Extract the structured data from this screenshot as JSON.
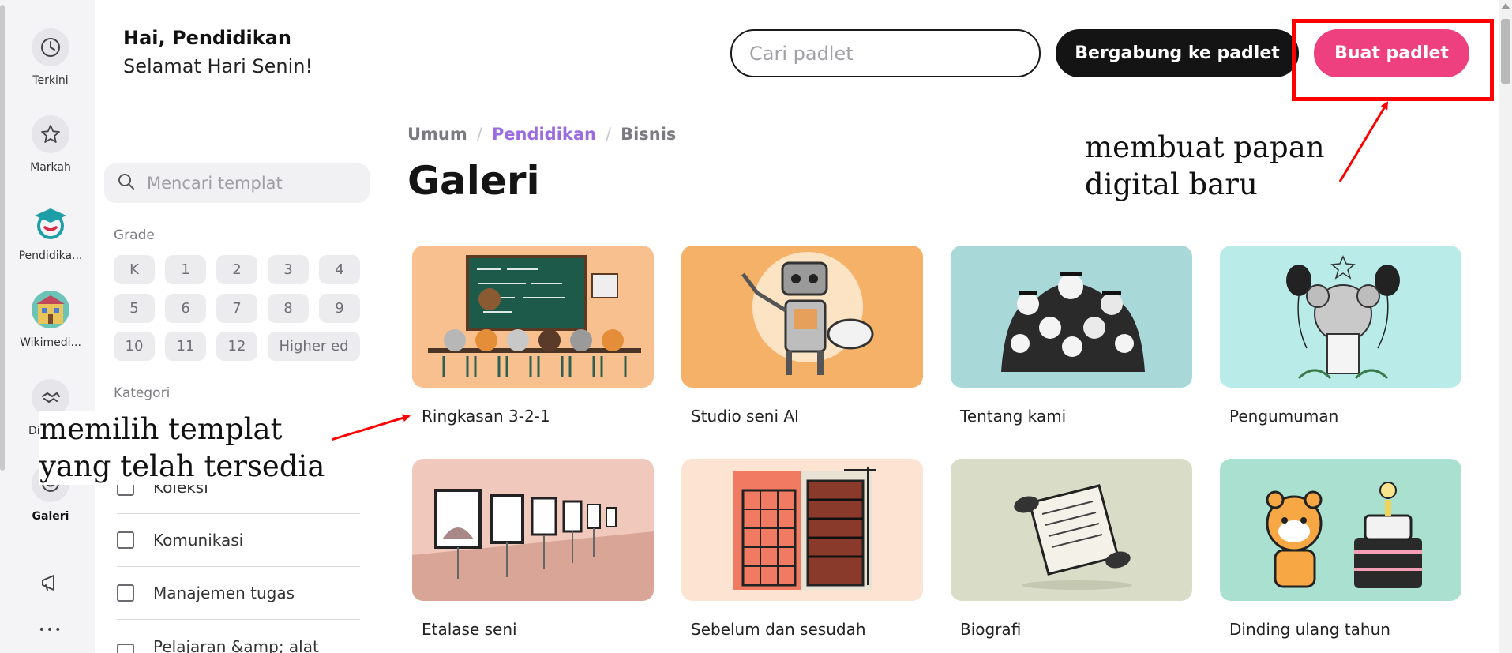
{
  "rail": {
    "items": [
      {
        "label": "Terkini",
        "icon": "clock-icon"
      },
      {
        "label": "Markah",
        "icon": "star-icon"
      },
      {
        "label": "Pendidika...",
        "icon": "graduation-cap-icon"
      },
      {
        "label": "Wikimedi...",
        "icon": "building-avatar-icon"
      },
      {
        "label": "Dis",
        "icon": "handshake-icon"
      },
      {
        "label": "Galeri",
        "icon": "gallery-icon"
      },
      {
        "label": "",
        "icon": "megaphone-icon"
      },
      {
        "label": "",
        "icon": "more-icon"
      }
    ],
    "more_glyph": "•••"
  },
  "header": {
    "greeting": "Hai, Pendidikan",
    "day_message": "Selamat Hari Senin!",
    "search_placeholder": "Cari padlet",
    "join_label": "Bergabung ke padlet",
    "create_label": "Buat padlet"
  },
  "filters": {
    "search_placeholder": "Mencari templat",
    "grade_label": "Grade",
    "grades": [
      "K",
      "1",
      "2",
      "3",
      "4",
      "5",
      "6",
      "7",
      "8",
      "9",
      "10",
      "11",
      "12",
      "Higher ed"
    ],
    "category_label": "Kategori",
    "categories": [
      "Koleksi",
      "Komunikasi",
      "Manajemen tugas",
      "Pelajaran &amp; alat"
    ]
  },
  "main": {
    "breadcrumb": [
      "Umum",
      "Pendidikan",
      "Bisnis"
    ],
    "breadcrumb_separator": "/",
    "title": "Galeri",
    "cards": [
      {
        "title": "Ringkasan 3-2-1",
        "bg": "#f8c08e"
      },
      {
        "title": "Studio seni AI",
        "bg": "#f6b168"
      },
      {
        "title": "Tentang kami",
        "bg": "#a9d8d8"
      },
      {
        "title": "Pengumuman",
        "bg": "#b9ece8"
      },
      {
        "title": "Etalase seni",
        "bg": "#f1c8bc"
      },
      {
        "title": "Sebelum dan sesudah",
        "bg": "#fde3d1"
      },
      {
        "title": "Biografi",
        "bg": "#d9dcc6"
      },
      {
        "title": "Dinding ulang tahun",
        "bg": "#a9e0cf"
      }
    ]
  },
  "annotations": {
    "create_note": [
      "membuat papan",
      "digital baru"
    ],
    "template_note": [
      "memilih templat",
      "yang telah tersedia"
    ]
  },
  "colors": {
    "accent_pink": "#ee3f7f",
    "accent_purple": "#9b6be0",
    "annotation_red": "#ff0000"
  }
}
